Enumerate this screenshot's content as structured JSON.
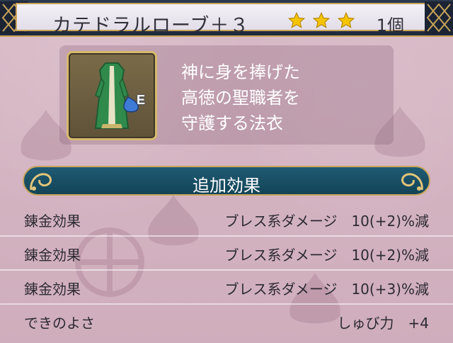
{
  "header": {
    "item_name": "カテドラルローブ＋３",
    "stars_count": 3,
    "quantity": "1個"
  },
  "item": {
    "icon": "robe-icon",
    "equipped_mark": "E",
    "description_lines": [
      "神に身を捧げた",
      "高徳の聖職者を",
      "守護する法衣"
    ]
  },
  "section": {
    "title": "追加効果"
  },
  "effects": [
    {
      "label": "錬金効果",
      "value": "ブレス系ダメージ　10(+2)%減"
    },
    {
      "label": "錬金効果",
      "value": "ブレス系ダメージ　10(+2)%減"
    },
    {
      "label": "錬金効果",
      "value": "ブレス系ダメージ　10(+3)%減"
    },
    {
      "label": "できのよさ",
      "value": "しゅび力　+4"
    }
  ],
  "colors": {
    "header_bg": "#1f2a3c",
    "gold_border": "#c8a45a",
    "section_bar": "#1f5a73",
    "page_bg": "#d7b6c3",
    "star": "#f5c400"
  }
}
